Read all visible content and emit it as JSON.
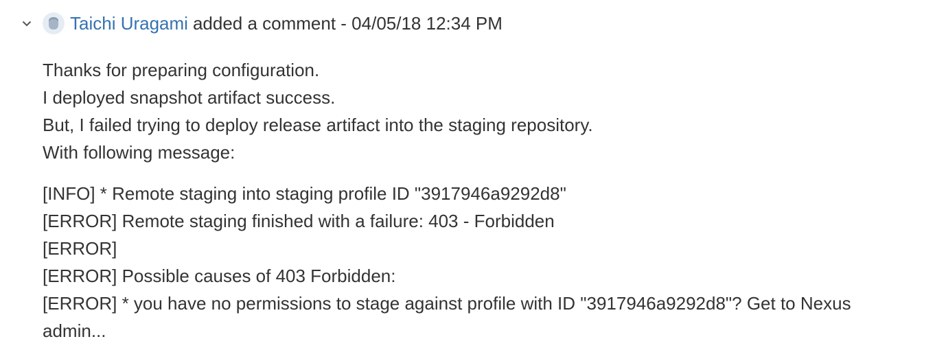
{
  "comment": {
    "author": "Taichi Uragami",
    "action": "added a comment - 04/05/18 12:34 PM",
    "paragraph": [
      "Thanks for preparing configuration.",
      "I deployed snapshot artifact success.",
      "But, I failed trying to deploy release artifact into the staging repository.",
      "With following message:"
    ],
    "log": [
      "[INFO] * Remote staging into staging profile ID \"3917946a9292d8\"",
      "[ERROR] Remote staging finished with a failure: 403 - Forbidden",
      "[ERROR]",
      "[ERROR] Possible causes of 403 Forbidden:",
      "[ERROR] * you have no permissions to stage against profile with ID \"3917946a9292d8\"? Get to Nexus",
      "admin..."
    ]
  }
}
